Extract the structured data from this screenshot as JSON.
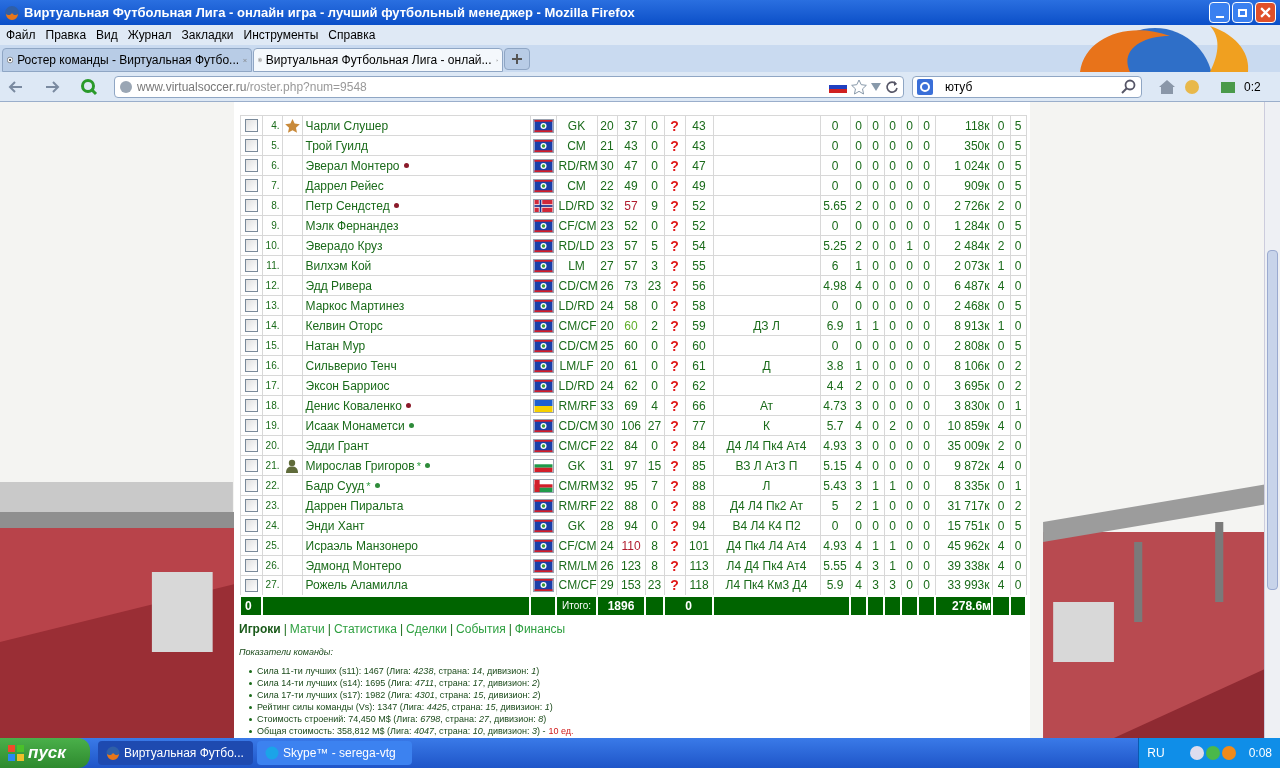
{
  "window": {
    "title": "Виртуальная Футбольная Лига - онлайн игра - лучший футбольный менеджер - Mozilla Firefox"
  },
  "menu": [
    "Файл",
    "Правка",
    "Вид",
    "Журнал",
    "Закладки",
    "Инструменты",
    "Справка"
  ],
  "tabs": [
    {
      "label": "Ростер команды - Виртуальная Футбо...",
      "selected": false
    },
    {
      "label": "Виртуальная Футбольная Лига - онлай...",
      "selected": true
    }
  ],
  "address": {
    "host": "www.virtualsoccer.ru",
    "path": "/roster.php?num=9548"
  },
  "search": {
    "value": "ютуб"
  },
  "toolbar_badge": "0:2",
  "rows": [
    {
      "checked": false,
      "num": "4.",
      "badge": {
        "kind": "star"
      },
      "name": "Чарли Слушер",
      "flag": {
        "kind": "belize"
      },
      "pos": "GK",
      "age": "20",
      "skill": {
        "text": "37",
        "color": "#1a6b1a"
      },
      "col": "0",
      "q": "?",
      "power": "43",
      "rating": "0",
      "stats": [
        "0",
        "0",
        "0",
        "0",
        "0"
      ],
      "value": "118к",
      "c1": "0",
      "c2": "5"
    },
    {
      "checked": false,
      "num": "5.",
      "name": "Трой Гуилд",
      "flag": {
        "kind": "belize"
      },
      "pos": "CM",
      "age": "21",
      "skill": {
        "text": "43",
        "color": "#1a6b1a"
      },
      "col": "0",
      "q": "?",
      "power": "43",
      "rating": "0",
      "stats": [
        "0",
        "0",
        "0",
        "0",
        "0"
      ],
      "value": "350к",
      "c1": "0",
      "c2": "5"
    },
    {
      "checked": false,
      "num": "6.",
      "name": "Эверал Монтеро",
      "dot": {
        "color": "#8b1a2a"
      },
      "flag": {
        "kind": "belize"
      },
      "pos": "RD/RM",
      "age": "30",
      "skill": {
        "text": "47",
        "color": "#1a6b1a"
      },
      "col": "0",
      "q": "?",
      "power": "47",
      "rating": "0",
      "stats": [
        "0",
        "0",
        "0",
        "0",
        "0"
      ],
      "value": "1 024к",
      "c1": "0",
      "c2": "5"
    },
    {
      "checked": false,
      "num": "7.",
      "name": "Даррел Рейес",
      "flag": {
        "kind": "belize"
      },
      "pos": "CM",
      "age": "22",
      "skill": {
        "text": "49",
        "color": "#1a6b1a"
      },
      "col": "0",
      "q": "?",
      "power": "49",
      "rating": "0",
      "stats": [
        "0",
        "0",
        "0",
        "0",
        "0"
      ],
      "value": "909к",
      "c1": "0",
      "c2": "5"
    },
    {
      "checked": false,
      "num": "8.",
      "name": "Петр Сендстед",
      "dot": {
        "color": "#8b1a2a"
      },
      "flag": {
        "kind": "norway"
      },
      "pos": "LD/RD",
      "age": "32",
      "skill": {
        "text": "57",
        "color": "#b01c2e"
      },
      "col": "9",
      "q": "?",
      "power": "52",
      "rating": "5.65",
      "stats": [
        "2",
        "0",
        "0",
        "0",
        "0"
      ],
      "value": "2 726к",
      "c1": "2",
      "c2": "0"
    },
    {
      "checked": false,
      "num": "9.",
      "name": "Мэлк Фернандез",
      "flag": {
        "kind": "belize"
      },
      "pos": "CF/CM",
      "age": "23",
      "skill": {
        "text": "52",
        "color": "#1a6b1a"
      },
      "col": "0",
      "q": "?",
      "power": "52",
      "rating": "0",
      "stats": [
        "0",
        "0",
        "0",
        "0",
        "0"
      ],
      "value": "1 284к",
      "c1": "0",
      "c2": "5"
    },
    {
      "checked": false,
      "num": "10.",
      "name": "Эверадо Круз",
      "flag": {
        "kind": "belize"
      },
      "pos": "RD/LD",
      "age": "23",
      "skill": {
        "text": "57",
        "color": "#1a6b1a"
      },
      "col": "5",
      "q": "?",
      "power": "54",
      "rating": "5.25",
      "stats": [
        "2",
        "0",
        "0",
        "1",
        "0"
      ],
      "value": "2 484к",
      "c1": "2",
      "c2": "0"
    },
    {
      "checked": false,
      "num": "11.",
      "name": "Вилхэм Кой",
      "flag": {
        "kind": "belize"
      },
      "pos": "LM",
      "age": "27",
      "skill": {
        "text": "57",
        "color": "#1a6b1a"
      },
      "col": "3",
      "q": "?",
      "power": "55",
      "rating": "6",
      "stats": [
        "1",
        "0",
        "0",
        "0",
        "0"
      ],
      "value": "2 073к",
      "c1": "1",
      "c2": "0"
    },
    {
      "checked": false,
      "num": "12.",
      "name": "Эдд Ривера",
      "flag": {
        "kind": "belize"
      },
      "pos": "CD/CM",
      "age": "26",
      "skill": {
        "text": "73",
        "color": "#1a6b1a"
      },
      "col": "23",
      "q": "?",
      "power": "56",
      "rating": "4.98",
      "stats": [
        "4",
        "0",
        "0",
        "0",
        "0"
      ],
      "value": "6 487к",
      "c1": "4",
      "c2": "0"
    },
    {
      "checked": false,
      "num": "13.",
      "name": "Маркос Мартинез",
      "flag": {
        "kind": "belize"
      },
      "pos": "LD/RD",
      "age": "24",
      "skill": {
        "text": "58",
        "color": "#1a6b1a"
      },
      "col": "0",
      "q": "?",
      "power": "58",
      "rating": "0",
      "stats": [
        "0",
        "0",
        "0",
        "0",
        "0"
      ],
      "value": "2 468к",
      "c1": "0",
      "c2": "5"
    },
    {
      "checked": false,
      "num": "14.",
      "name": "Келвин Оторс",
      "flag": {
        "kind": "belize"
      },
      "pos": "CM/CF",
      "age": "20",
      "skill": {
        "text": "60",
        "color": "#5fae2a"
      },
      "col": "2",
      "q": "?",
      "power": "59",
      "spec": "ДЗ Л",
      "rating": "6.9",
      "stats": [
        "1",
        "1",
        "0",
        "0",
        "0"
      ],
      "value": "8 913к",
      "c1": "1",
      "c2": "0"
    },
    {
      "checked": false,
      "num": "15.",
      "name": "Натан Мур",
      "flag": {
        "kind": "belize"
      },
      "pos": "CD/CM",
      "age": "25",
      "skill": {
        "text": "60",
        "color": "#1a6b1a"
      },
      "col": "0",
      "q": "?",
      "power": "60",
      "rating": "0",
      "stats": [
        "0",
        "0",
        "0",
        "0",
        "0"
      ],
      "value": "2 808к",
      "c1": "0",
      "c2": "5"
    },
    {
      "checked": false,
      "num": "16.",
      "name": "Сильверио Тенч",
      "flag": {
        "kind": "belize"
      },
      "pos": "LM/LF",
      "age": "20",
      "skill": {
        "text": "61",
        "color": "#1a6b1a"
      },
      "col": "0",
      "q": "?",
      "power": "61",
      "spec": "Д",
      "rating": "3.8",
      "stats": [
        "1",
        "0",
        "0",
        "0",
        "0"
      ],
      "value": "8 106к",
      "c1": "0",
      "c2": "2"
    },
    {
      "checked": false,
      "num": "17.",
      "name": "Эксон Барриос",
      "flag": {
        "kind": "belize"
      },
      "pos": "LD/RD",
      "age": "24",
      "skill": {
        "text": "62",
        "color": "#1a6b1a"
      },
      "col": "0",
      "q": "?",
      "power": "62",
      "rating": "4.4",
      "stats": [
        "2",
        "0",
        "0",
        "0",
        "0"
      ],
      "value": "3 695к",
      "c1": "0",
      "c2": "2"
    },
    {
      "checked": false,
      "num": "18.",
      "name": "Денис Коваленко",
      "dot": {
        "color": "#8b1a2a"
      },
      "flag": {
        "kind": "ukraine"
      },
      "pos": "RM/RF",
      "age": "33",
      "skill": {
        "text": "69",
        "color": "#1a6b1a"
      },
      "col": "4",
      "q": "?",
      "power": "66",
      "spec": "Ат",
      "rating": "4.73",
      "stats": [
        "3",
        "0",
        "0",
        "0",
        "0"
      ],
      "value": "3 830к",
      "c1": "0",
      "c2": "1"
    },
    {
      "checked": false,
      "num": "19.",
      "name": "Исаак Монаметси",
      "dot": {
        "color": "#2e8b3a"
      },
      "flag": {
        "kind": "belize"
      },
      "pos": "CD/CM",
      "age": "30",
      "skill": {
        "text": "106",
        "color": "#1a6b1a"
      },
      "col": "27",
      "q": "?",
      "power": "77",
      "spec": "К",
      "rating": "5.7",
      "stats": [
        "4",
        "0",
        "2",
        "0",
        "0"
      ],
      "value": "10 859к",
      "c1": "4",
      "c2": "0"
    },
    {
      "checked": false,
      "num": "20.",
      "name": "Эдди Грант",
      "flag": {
        "kind": "belize"
      },
      "pos": "CM/CF",
      "age": "22",
      "skill": {
        "text": "84",
        "color": "#1a6b1a"
      },
      "col": "0",
      "q": "?",
      "power": "84",
      "spec": "Д4 Л4 Пк4 Ат4",
      "rating": "4.93",
      "stats": [
        "3",
        "0",
        "0",
        "0",
        "0"
      ],
      "value": "35 009к",
      "c1": "2",
      "c2": "0"
    },
    {
      "checked": false,
      "num": "21.",
      "badge": {
        "kind": "person"
      },
      "name": "Мирослав Григоров",
      "asterisk": "*",
      "dot": {
        "color": "#2e8b3a"
      },
      "flag": {
        "kind": "bulgaria"
      },
      "pos": "GK",
      "age": "31",
      "skill": {
        "text": "97",
        "color": "#1a6b1a"
      },
      "col": "15",
      "q": "?",
      "power": "85",
      "spec": "ВЗ Л АтЗ П",
      "rating": "5.15",
      "stats": [
        "4",
        "0",
        "0",
        "0",
        "0"
      ],
      "value": "9 872к",
      "c1": "4",
      "c2": "0"
    },
    {
      "checked": false,
      "num": "22.",
      "name": "Бадр Сууд",
      "asterisk": "*",
      "dot": {
        "color": "#2e8b3a"
      },
      "flag": {
        "kind": "oman"
      },
      "pos": "CM/RM",
      "age": "32",
      "skill": {
        "text": "95",
        "color": "#1a6b1a"
      },
      "col": "7",
      "q": "?",
      "power": "88",
      "spec": "Л",
      "rating": "5.43",
      "stats": [
        "3",
        "1",
        "1",
        "0",
        "0"
      ],
      "value": "8 335к",
      "c1": "0",
      "c2": "1"
    },
    {
      "checked": false,
      "num": "23.",
      "name": "Даррен Пиральта",
      "flag": {
        "kind": "belize"
      },
      "pos": "RM/RF",
      "age": "22",
      "skill": {
        "text": "88",
        "color": "#1a6b1a"
      },
      "col": "0",
      "q": "?",
      "power": "88",
      "spec": "Д4 Л4 Пк2 Ат",
      "rating": "5",
      "stats": [
        "2",
        "1",
        "0",
        "0",
        "0"
      ],
      "value": "31 717к",
      "c1": "0",
      "c2": "2"
    },
    {
      "checked": false,
      "num": "24.",
      "name": "Энди Хант",
      "flag": {
        "kind": "belize"
      },
      "pos": "GK",
      "age": "28",
      "skill": {
        "text": "94",
        "color": "#1a6b1a"
      },
      "col": "0",
      "q": "?",
      "power": "94",
      "spec": "В4 Л4 К4 П2",
      "rating": "0",
      "stats": [
        "0",
        "0",
        "0",
        "0",
        "0"
      ],
      "value": "15 751к",
      "c1": "0",
      "c2": "5"
    },
    {
      "checked": false,
      "num": "25.",
      "name": "Исраэль Манзонеро",
      "flag": {
        "kind": "belize"
      },
      "pos": "CF/CM",
      "age": "24",
      "skill": {
        "text": "110",
        "color": "#b01c2e"
      },
      "col": "8",
      "q": "?",
      "power": "101",
      "spec": "Д4 Пк4 Л4 Ат4",
      "rating": "4.93",
      "stats": [
        "4",
        "1",
        "1",
        "0",
        "0"
      ],
      "value": "45 962к",
      "c1": "4",
      "c2": "0"
    },
    {
      "checked": false,
      "num": "26.",
      "name": "Эдмонд Монтеро",
      "flag": {
        "kind": "belize"
      },
      "pos": "RM/LM",
      "age": "26",
      "skill": {
        "text": "123",
        "color": "#1a6b1a"
      },
      "col": "8",
      "q": "?",
      "power": "113",
      "spec": "Л4 Д4 Пк4 Ат4",
      "rating": "5.55",
      "stats": [
        "4",
        "3",
        "1",
        "0",
        "0"
      ],
      "value": "39 338к",
      "c1": "4",
      "c2": "0"
    },
    {
      "checked": false,
      "num": "27.",
      "name": "Рожель Аламилла",
      "flag": {
        "kind": "belize"
      },
      "pos": "CM/CF",
      "age": "29",
      "skill": {
        "text": "153",
        "color": "#1a6b1a"
      },
      "col": "23",
      "q": "?",
      "power": "118",
      "spec": "Л4 Пк4 Км3 Д4",
      "rating": "5.9",
      "stats": [
        "4",
        "3",
        "3",
        "0",
        "0"
      ],
      "value": "33 993к",
      "c1": "4",
      "c2": "0"
    }
  ],
  "totals": {
    "count": "0",
    "label": "Итого:",
    "skill": "1896",
    "power": "0",
    "value": "278.6м"
  },
  "links": [
    {
      "label": "Игроки",
      "selected": true
    },
    {
      "label": "Матчи",
      "selected": false
    },
    {
      "label": "Статистика",
      "selected": false
    },
    {
      "label": "Сделки",
      "selected": false
    },
    {
      "label": "События",
      "selected": false
    },
    {
      "label": "Финансы",
      "selected": false
    }
  ],
  "separator": "|",
  "stats_heading": "Показатели команды:",
  "stats": [
    {
      "text": "Сила 11-ти лучших (s11): 1467 (Лига: *4238*, страна: *14*, дивизион: *1*)"
    },
    {
      "text": "Сила 14-ти лучших (s14): 1695 (Лига: *4711*, страна: *17*, дивизион: *2*)"
    },
    {
      "text": "Сила 17-ти лучших (s17): 1982 (Лига: *4301*, страна: *15*, дивизион: *2*)"
    },
    {
      "text": "Рейтинг силы команды (Vs): 1347 (Лига: *4425*, страна: *15*, дивизион: *1*)"
    },
    {
      "text": "Стоимость строений: 74,450 M$ (Лига: *6798*, страна: *27*, дивизион: *8*)"
    },
    {
      "text": "Общая стоимость: 358,812 M$ (Лига: *4047*, страна: *10*, дивизион: *3*) -",
      "note": "10 ед."
    }
  ],
  "taskbar": {
    "start": "пуск",
    "tasks": [
      {
        "label": "Виртуальная Футбо...",
        "kind": "browser",
        "selected": true
      },
      {
        "label": "Skype™ - serega-vtg",
        "kind": "skype",
        "selected": false
      }
    ],
    "language": "RU",
    "clock": "0:08"
  }
}
